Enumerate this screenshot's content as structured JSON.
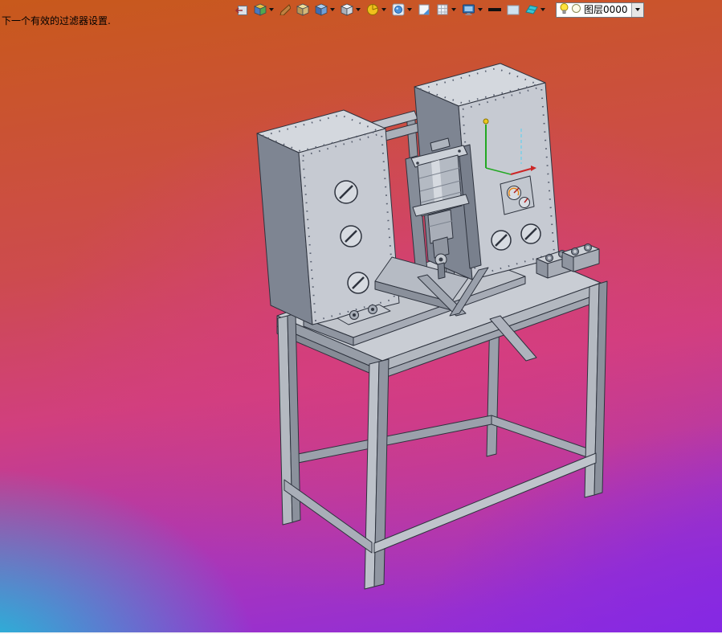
{
  "app": {
    "status_text": "下一个有效的过滤器设置."
  },
  "toolbar": {
    "layer_value": "图层0000",
    "icons": [
      "exit-icon",
      "view-cube-icon",
      "dart-icon",
      "tan-box-icon",
      "blue-cube-icon",
      "gray-cube-icon",
      "sphere-icon",
      "zoom-lens-icon",
      "plane-icon",
      "grid-icon",
      "monitor-icon",
      "line-width-icon",
      "color-swatch-icon",
      "surface-icon",
      "lightbulb-icon",
      "layer-color-icon"
    ]
  },
  "viewport": {
    "background_colors": {
      "top": "#c8591b",
      "center_pink": "#d13f7e",
      "bottom_left_cyan": "#18c5da",
      "bottom_right_purple": "#8c2bdf"
    },
    "model_colors": {
      "panel_front": "#c6cad2",
      "panel_top": "#d4d8de",
      "panel_side": "#7e8592",
      "outline": "#2e333e",
      "axis_green": "#22a822",
      "axis_red": "#cc2626",
      "axis_origin_yellow": "#ecc81e"
    }
  }
}
